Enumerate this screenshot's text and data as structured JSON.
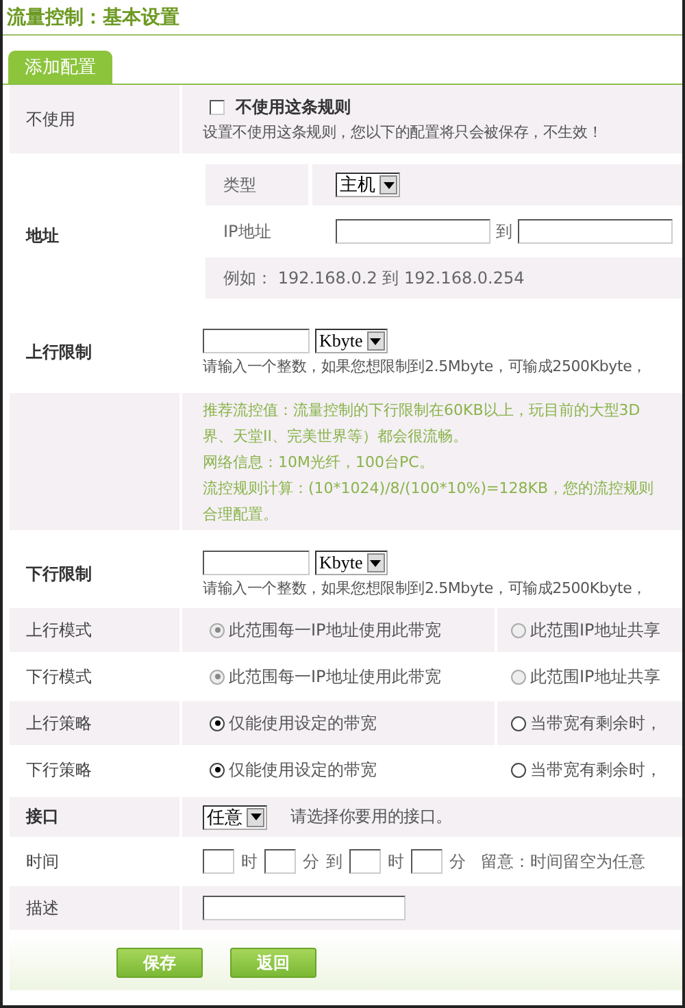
{
  "title": "流量控制：基本设置",
  "tabs": [
    {
      "label": "添加配置",
      "selected": true
    }
  ],
  "disable_rule": {
    "label": "不使用",
    "checkbox_label": "不使用这条规则",
    "checked": false,
    "note": "设置不使用这条规则，您以下的配置将只会被保存，不生效！"
  },
  "address": {
    "label": "地址",
    "type_label": "类型",
    "type_value": "主机",
    "ip_label": "IP地址",
    "to": "到",
    "example": "例如：  192.168.0.2 到  192.168.0.254"
  },
  "upload_limit": {
    "label": "上行限制",
    "unit": "Kbyte",
    "hint": "请输入一个整数，如果您想限制到2.5Mbyte，可输成2500Kbyte，"
  },
  "info_lines": [
    "推荐流控值：流量控制的下行限制在60KB以上，玩目前的大型3D",
    "界、天堂II、完美世界等）都会很流畅。",
    "网络信息：10M光纤，100台PC。",
    "流控规则计算：(10*1024)/8/(100*10%)=128KB，您的流控规则",
    "合理配置。"
  ],
  "download_limit": {
    "label": "下行限制",
    "unit": "Kbyte",
    "hint": "请输入一个整数，如果您想限制到2.5Mbyte，可输成2500Kbyte，"
  },
  "radio_rows": [
    {
      "label": "上行模式",
      "options": [
        {
          "label": "此范围每一IP地址使用此带宽",
          "selected": true,
          "disabled": true
        },
        {
          "label": "此范围IP地址共享",
          "selected": false,
          "disabled": true
        }
      ]
    },
    {
      "label": "下行模式",
      "options": [
        {
          "label": "此范围每一IP地址使用此带宽",
          "selected": true,
          "disabled": true
        },
        {
          "label": "此范围IP地址共享",
          "selected": false,
          "disabled": true
        }
      ]
    },
    {
      "label": "上行策略",
      "options": [
        {
          "label": "仅能使用设定的带宽",
          "selected": true,
          "disabled": false
        },
        {
          "label": "当带宽有剩余时，",
          "selected": false,
          "disabled": false
        }
      ]
    },
    {
      "label": "下行策略",
      "options": [
        {
          "label": "仅能使用设定的带宽",
          "selected": true,
          "disabled": false
        },
        {
          "label": "当带宽有剩余时，",
          "selected": false,
          "disabled": false
        }
      ]
    }
  ],
  "interface": {
    "label": "接口",
    "value": "任意",
    "hint": "请选择你要用的接口。"
  },
  "time": {
    "label": "时间",
    "segments": [
      {
        "kind": "input"
      },
      {
        "kind": "text",
        "text": "时"
      },
      {
        "kind": "input"
      },
      {
        "kind": "text",
        "text": "分"
      },
      {
        "kind": "text",
        "text": "到"
      },
      {
        "kind": "input"
      },
      {
        "kind": "text",
        "text": "时"
      },
      {
        "kind": "input"
      },
      {
        "kind": "text",
        "text": "分"
      },
      {
        "kind": "note",
        "text": "留意：时间留空为任意"
      }
    ]
  },
  "description": {
    "label": "描述"
  },
  "buttons": [
    "保存",
    "返回"
  ]
}
